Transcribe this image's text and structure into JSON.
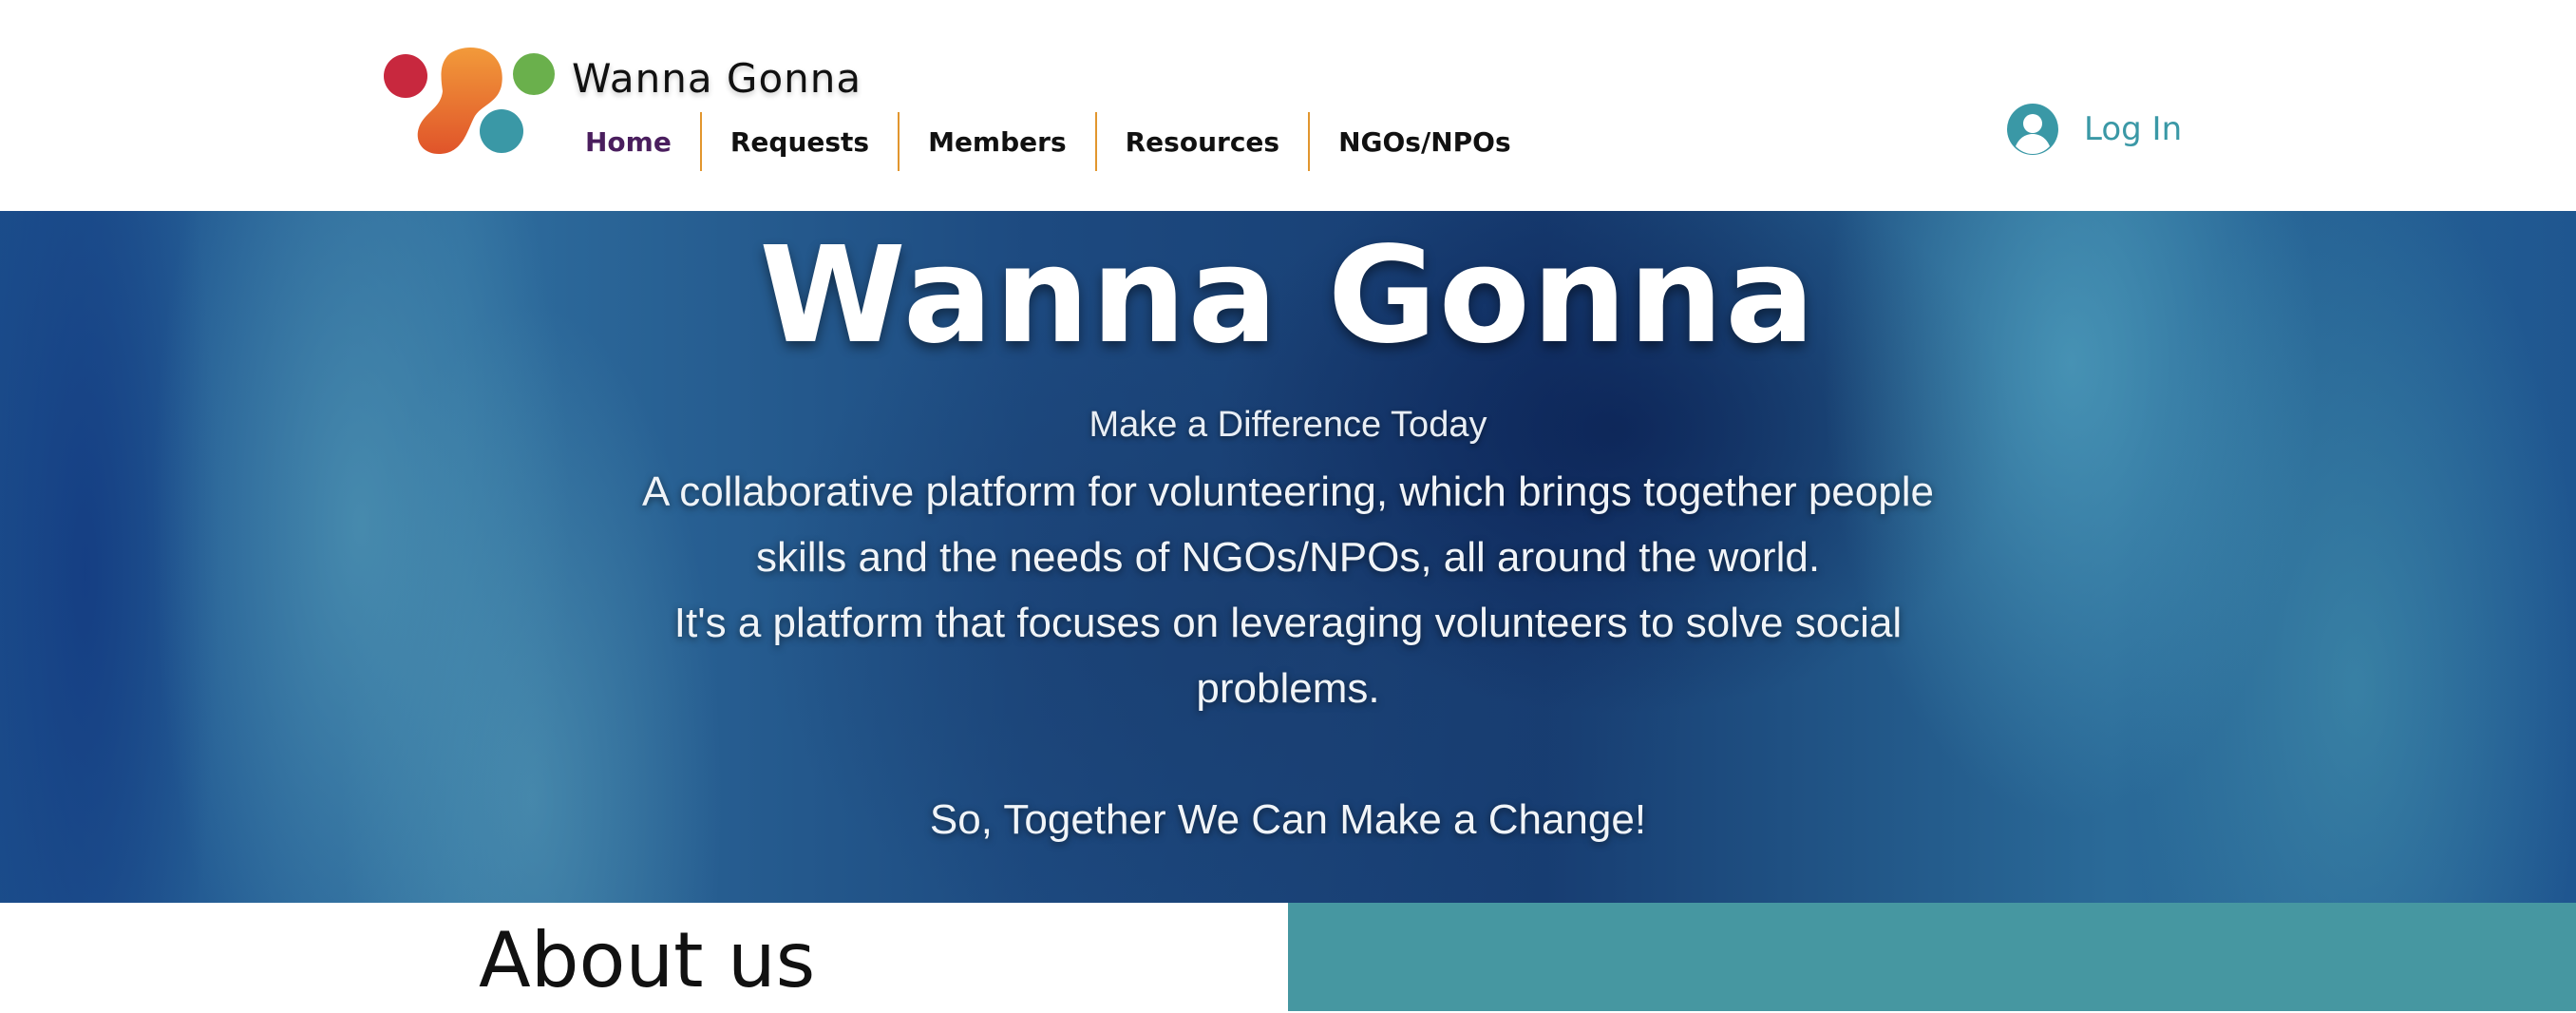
{
  "header": {
    "brand": "Wanna Gonna",
    "logo_icon": "colored-dots-logo",
    "nav": [
      {
        "label": "Home",
        "active": true
      },
      {
        "label": "Requests",
        "active": false
      },
      {
        "label": "Members",
        "active": false
      },
      {
        "label": "Resources",
        "active": false
      },
      {
        "label": "NGOs/NPOs",
        "active": false
      }
    ],
    "login": {
      "label": "Log In",
      "icon": "user-avatar-icon"
    }
  },
  "hero": {
    "title": "Wanna Gonna",
    "subtitle": "Make a Difference Today",
    "lines": [
      "A collaborative platform for volunteering, which brings together people",
      "skills and the needs of NGOs/NPOs, all around the world.",
      "It's a platform that focuses on leveraging volunteers to solve social",
      "problems.",
      "So, Together We Can Make a Change!"
    ]
  },
  "about": {
    "title": "About us"
  },
  "colors": {
    "accent_teal": "#4697a1",
    "nav_divider": "#e2962e",
    "active_nav": "#4a1e5e",
    "login_text": "#3a98a6",
    "logo_red": "#c8283e",
    "logo_orange": "#ea7a2a",
    "logo_green": "#6ab04c",
    "logo_teal": "#3a98a6"
  }
}
